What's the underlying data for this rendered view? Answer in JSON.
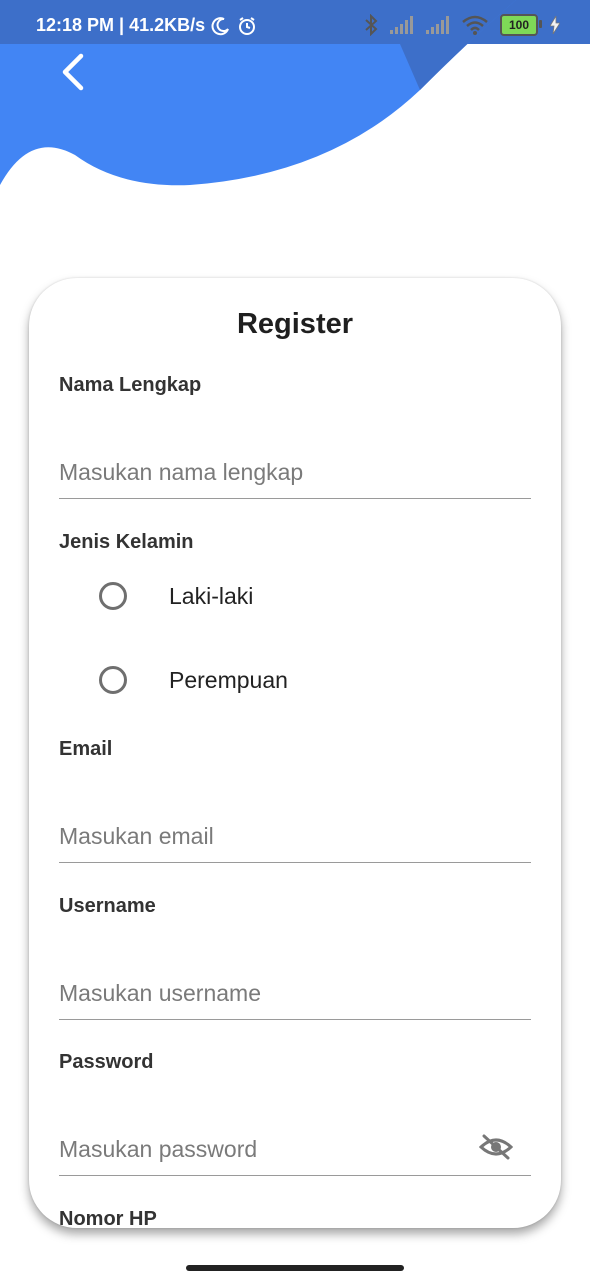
{
  "status_bar": {
    "time_speed": "12:18 PM | 41.2KB/s",
    "battery": "100"
  },
  "form": {
    "title": "Register",
    "fields": {
      "nama": {
        "label": "Nama Lengkap",
        "placeholder": "Masukan nama lengkap",
        "value": ""
      },
      "gender": {
        "label": "Jenis Kelamin",
        "options": [
          "Laki-laki",
          "Perempuan"
        ]
      },
      "email": {
        "label": "Email",
        "placeholder": "Masukan email",
        "value": ""
      },
      "username": {
        "label": "Username",
        "placeholder": "Masukan username",
        "value": ""
      },
      "password": {
        "label": "Password",
        "placeholder": "Masukan password",
        "value": ""
      },
      "phone": {
        "label": "Nomor HP"
      }
    }
  },
  "colors": {
    "accent": "#4285F4",
    "status_bg": "#3d6fc9",
    "battery": "#7ed957"
  },
  "icons": {
    "back": "chevron-left-icon",
    "password_toggle": "eye-off-icon"
  }
}
